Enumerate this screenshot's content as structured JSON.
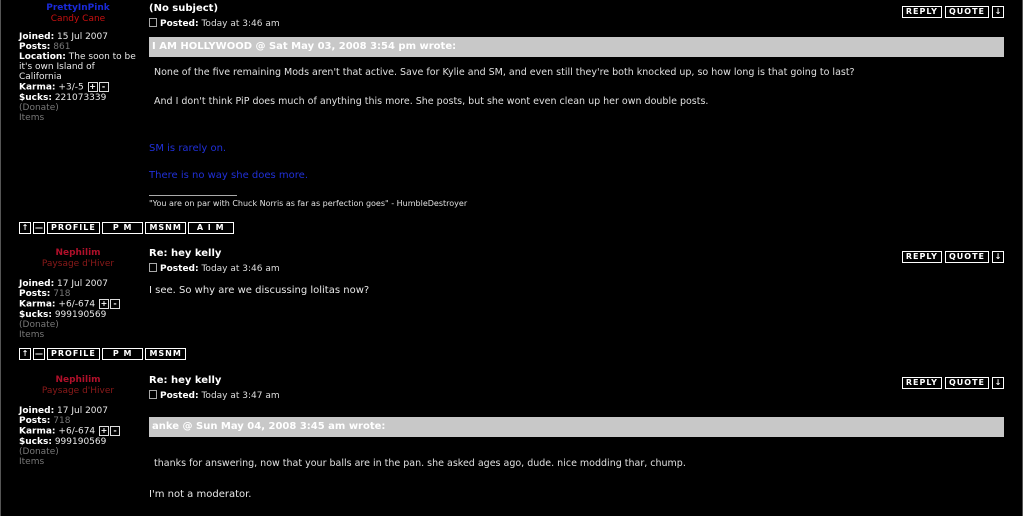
{
  "posts": [
    {
      "user": {
        "name": "PrettyInPink",
        "title": "Candy Cane",
        "joined": "15 Jul 2007",
        "posts": "861",
        "location": "The soon to be it's own Island of California",
        "karma": "+3/-5",
        "sucks": "221073339",
        "donate": "(Donate)",
        "items": "Items"
      },
      "subject": "(No subject)",
      "posted_label": "Posted:",
      "posted": "Today at 3:46 am",
      "quote_header": "I AM HOLLYWOOD @ Sat May 03, 2008 3:54 pm wrote:",
      "quote_lines": [
        "None of the five remaining Mods aren't that active. Save for Kylie and SM, and even still they're both knocked up, so how long is that going to last?",
        "And I don't think PiP does much of anything this more. She posts, but she wont even clean up her own double posts."
      ],
      "reply_lines": [
        "SM is rarely on.",
        "There is no way she does more."
      ],
      "signature": "\"You are on par with Chuck Norris as far as perfection goes\" - HumbleDestroyer",
      "bottom_buttons": [
        "↑",
        "—",
        "PROFILE",
        "P M",
        "MSNM",
        "A I M"
      ]
    },
    {
      "user": {
        "name": "Nephilim",
        "title": "Paysage d'Hiver",
        "joined": "17 Jul 2007",
        "posts": "718",
        "karma": "+6/-674",
        "sucks": "999190569",
        "donate": "(Donate)",
        "items": "Items"
      },
      "subject": "Re: hey kelly",
      "posted_label": "Posted:",
      "posted": "Today at 3:46 am",
      "body": "I see. So why are we discussing lolitas now?",
      "bottom_buttons": [
        "↑",
        "—",
        "PROFILE",
        "P M",
        "MSNM"
      ]
    },
    {
      "user": {
        "name": "Nephilim",
        "title": "Paysage d'Hiver",
        "joined": "17 Jul 2007",
        "posts": "718",
        "karma": "+6/-674",
        "sucks": "999190569",
        "donate": "(Donate)",
        "items": "Items"
      },
      "subject": "Re: hey kelly",
      "posted_label": "Posted:",
      "posted": "Today at 3:47 am",
      "quote_header": "anke @ Sun May 04, 2008 3:45 am wrote:",
      "quote_lines": [
        "thanks for answering, now that your balls are in the pan. she asked ages ago, dude. nice modding thar, chump."
      ],
      "body": "I'm not a moderator."
    }
  ],
  "labels": {
    "joined": "Joined:",
    "posts": "Posts:",
    "location": "Location:",
    "karma": "Karma:",
    "sucks": "$ucks:",
    "reply": "REPLY",
    "quote": "QUOTE",
    "down": "↓",
    "plus": "+",
    "minus": "-"
  }
}
